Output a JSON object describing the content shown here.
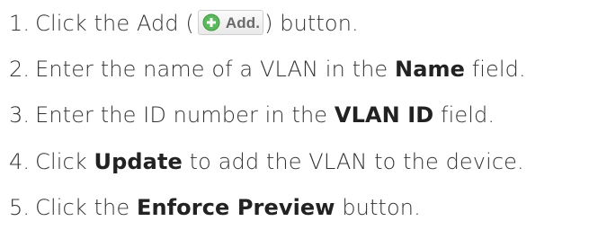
{
  "steps": [
    {
      "number": "1.",
      "text_a": "Click the Add (",
      "button_label": "Add.",
      "text_b": ") button."
    },
    {
      "number": "2.",
      "text_a": "Enter the name of a VLAN in the ",
      "bold": "Name",
      "text_b": " field."
    },
    {
      "number": "3.",
      "text_a": "Enter the ID number in the ",
      "bold": "VLAN ID",
      "text_b": " field."
    },
    {
      "number": "4.",
      "text_a": "Click ",
      "bold": "Update",
      "text_b": " to add the VLAN to the device."
    },
    {
      "number": "5.",
      "text_a": "Click the ",
      "bold": "Enforce Preview",
      "text_b": " button."
    }
  ],
  "icons": {
    "add_icon": "plus-circle-icon",
    "add_icon_color": "#5cb85c"
  }
}
